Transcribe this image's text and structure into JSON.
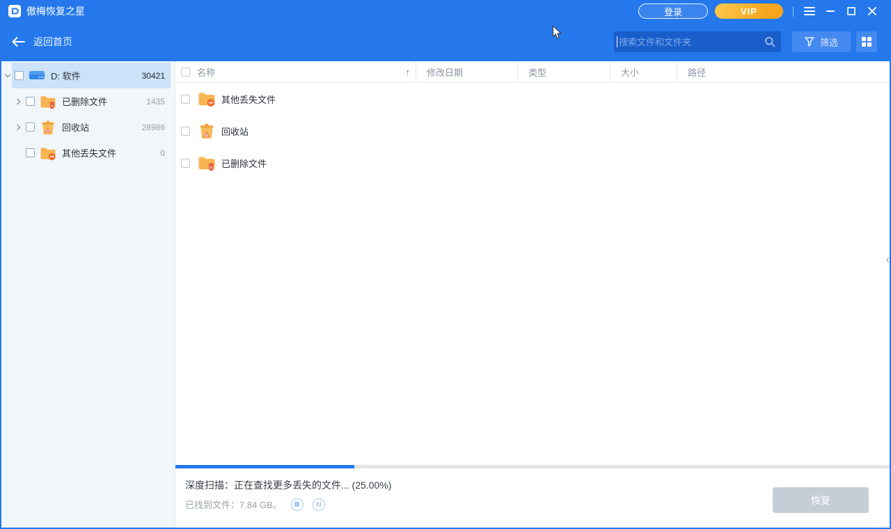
{
  "app": {
    "title": "傲梅恢复之星"
  },
  "titlebar": {
    "login_label": "登录",
    "vip_label": "VIP"
  },
  "toolbar": {
    "back_label": "返回首页",
    "search_placeholder": "搜索文件和文件夹",
    "filter_label": "筛选"
  },
  "sidebar": {
    "items": [
      {
        "label": "D: 软件",
        "count": "30421",
        "icon": "drive-icon",
        "state": "expanded-selected"
      },
      {
        "label": "已删除文件",
        "count": "1435",
        "icon": "folder-deleted-icon",
        "state": "collapsed"
      },
      {
        "label": "回收站",
        "count": "28986",
        "icon": "recycle-bin-icon",
        "state": "collapsed"
      },
      {
        "label": "其他丢失文件",
        "count": "0",
        "icon": "folder-lost-icon",
        "state": "leaf"
      }
    ]
  },
  "table": {
    "columns": [
      "名称",
      "修改日期",
      "类型",
      "大小",
      "路径"
    ],
    "sort": {
      "column": "名称",
      "direction": "asc",
      "glyph": "↑"
    },
    "rows": [
      {
        "name": "其他丢失文件",
        "icon": "folder-lost-icon"
      },
      {
        "name": "回收站",
        "icon": "recycle-bin-icon"
      },
      {
        "name": "已删除文件",
        "icon": "folder-deleted-icon"
      }
    ]
  },
  "status": {
    "progress_percent": 25,
    "scan_line": "深度扫描：正在查找更多丢失的文件... (25.00%)",
    "found_line": "已找到文件：7.84 GB。",
    "recover_label": "恢复"
  },
  "colors": {
    "accent_blue": "#2478ec",
    "search_bg": "#1a5ecb",
    "toolbar_button_blue": "#4489ef",
    "vip_gradient_start": "#fdc94c",
    "vip_gradient_end": "#f6a61f",
    "sidebar_bg": "#f1f6fa",
    "selected_row": "#cbe2f8",
    "disabled_button": "#c6cdd7",
    "progress_fill": "#2478ec",
    "folder_orange": "#f8b452",
    "badge_red": "#e84b3c"
  }
}
